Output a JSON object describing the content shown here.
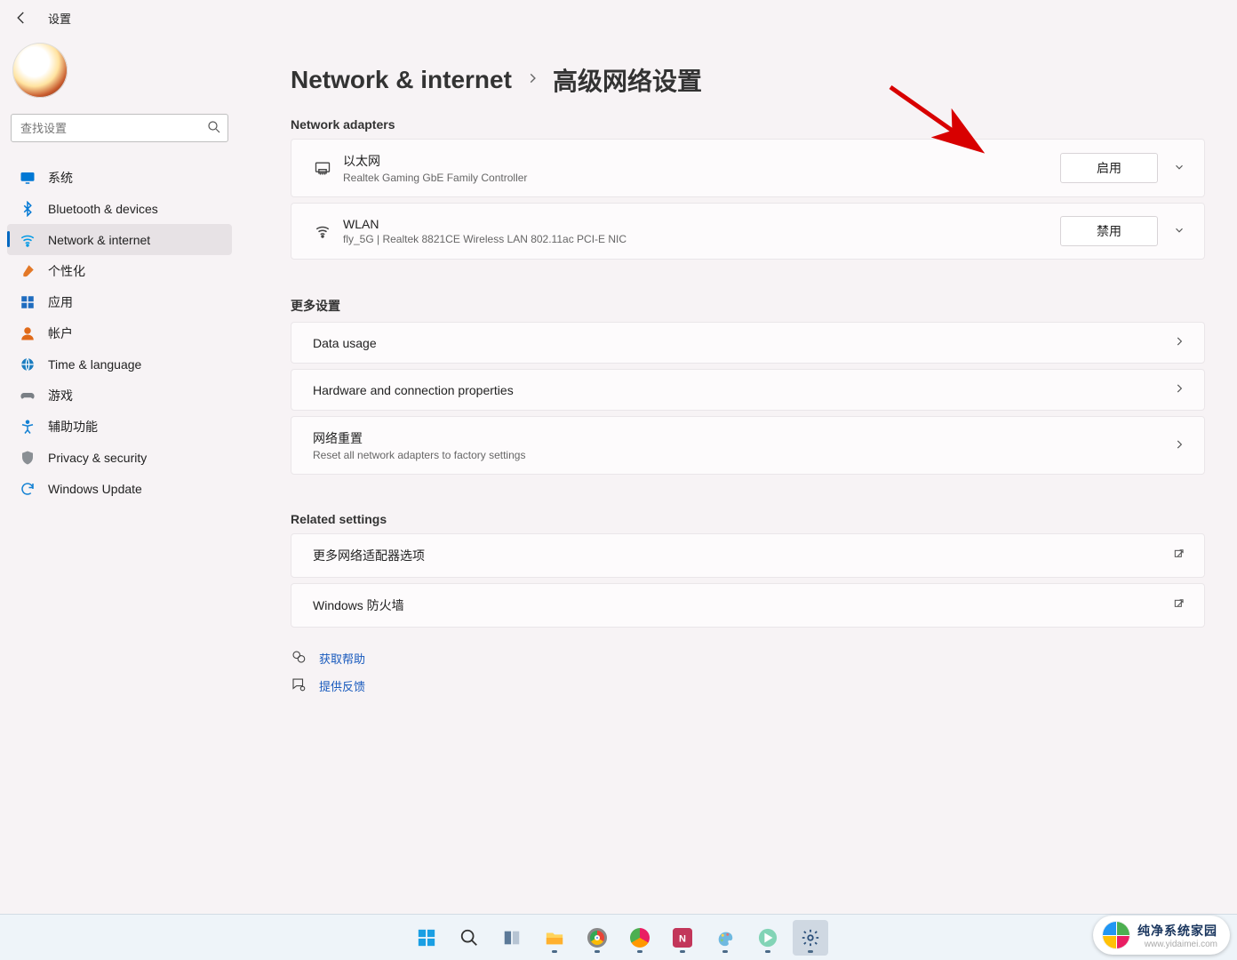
{
  "titlebar": {
    "title": "设置"
  },
  "search": {
    "placeholder": "查找设置"
  },
  "nav": [
    {
      "icon": "monitor-icon",
      "color": "#0078d4",
      "label": "系统"
    },
    {
      "icon": "bluetooth-icon",
      "color": "#0078d4",
      "label": "Bluetooth & devices"
    },
    {
      "icon": "wifi-icon",
      "color": "#0099e5",
      "label": "Network & internet",
      "selected": true
    },
    {
      "icon": "brush-icon",
      "color": "#e37827",
      "label": "个性化"
    },
    {
      "icon": "apps-icon",
      "color": "#1f6cbf",
      "label": "应用"
    },
    {
      "icon": "person-icon",
      "color": "#e06a1a",
      "label": "帐户"
    },
    {
      "icon": "globe-icon",
      "color": "#1c7dc0",
      "label": "Time & language"
    },
    {
      "icon": "gamepad-icon",
      "color": "#7a7f85",
      "label": "游戏"
    },
    {
      "icon": "accessibility-icon",
      "color": "#1180d3",
      "label": "辅助功能"
    },
    {
      "icon": "shield-icon",
      "color": "#8a8f94",
      "label": "Privacy & security"
    },
    {
      "icon": "update-icon",
      "color": "#1180d3",
      "label": "Windows Update"
    }
  ],
  "breadcrumb": {
    "parent": "Network & internet",
    "current": "高级网络设置"
  },
  "sections": {
    "adapters_title": "Network adapters",
    "adapters": [
      {
        "name": "以太网",
        "desc": "Realtek Gaming GbE Family Controller",
        "icon": "ethernet-icon",
        "button": "启用"
      },
      {
        "name": "WLAN",
        "desc": "fly_5G | Realtek 8821CE Wireless LAN 802.11ac PCI-E NIC",
        "icon": "wifi-icon",
        "button": "禁用"
      }
    ],
    "more_title": "更多设置",
    "more": [
      {
        "t1": "Data usage"
      },
      {
        "t1": "Hardware and connection properties"
      },
      {
        "t1": "网络重置",
        "t2": "Reset all network adapters to factory settings"
      }
    ],
    "related_title": "Related settings",
    "related": [
      {
        "t1": "更多网络适配器选项"
      },
      {
        "t1": "Windows 防火墙"
      }
    ]
  },
  "footer": {
    "help": "获取帮助",
    "feedback": "提供反馈"
  },
  "watermark": {
    "l1": "纯净系统家园",
    "l2": "www.yidaimei.com"
  }
}
